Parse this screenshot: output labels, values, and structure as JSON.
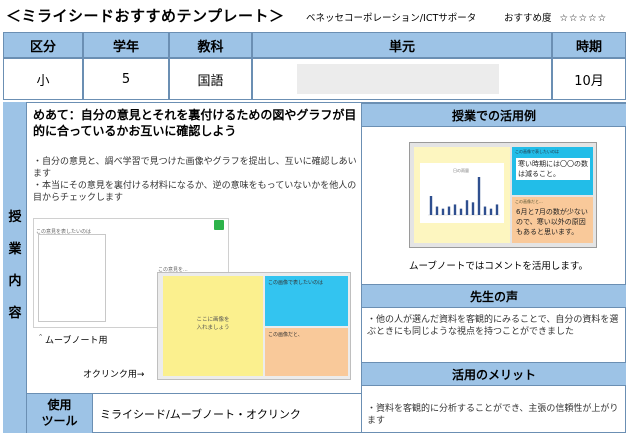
{
  "header": {
    "title": "＜ミライシードおすすめテンプレート＞",
    "org": "ベネッセコーポレーション/ICTサポータ",
    "recommend_label": "おすすめ度",
    "recommend_stars": "☆☆☆☆☆"
  },
  "table": {
    "columns": [
      "区分",
      "学年",
      "教科",
      "単元",
      "時期"
    ],
    "values": [
      "小",
      "5",
      "国語",
      "",
      "10月"
    ]
  },
  "side_label": [
    "授",
    "業",
    "内",
    "容"
  ],
  "lesson": {
    "meate": "めあて：自分の意見とそれを裏付けるための図やグラフが目的に合っているかお互いに確認しよう",
    "bullets": [
      "・自分の意見と、調べ学習で見つけた画像やグラフを提出し、互いに確認しあいます",
      "・本当にその意見を裏付ける材料になるか、逆の意味をもっていないかを他人の目からチェックします"
    ],
    "movenote_screen_title": "この意見を表したいのは",
    "movenote_screen2_title": "この意見を...",
    "movenote_caption": "＾ムーブノート用",
    "oclink_yellow_text": "ここに画像を\n入れましょう",
    "oclink_cyan_label": "この画像で表したいのは",
    "oclink_orange_label": "この画像だと、",
    "oclink_caption": "オクリンク用→"
  },
  "tools": {
    "label": "使用\nツール",
    "value": "ミライシード/ムーブノート・オクリンク"
  },
  "right": {
    "usage_title": "授業での活用例",
    "example_chart_title": "日の雨量",
    "example_cyan_label": "この画像で表したいのは",
    "example_note": "寒い時期には〇〇の数は減ること。",
    "example_orange_label": "この画像だと...",
    "example_orange_text": "6月と7月の数が少ないので、寒い以外の原因もあると思います。",
    "usage_caption": "ムーブノートではコメントを活用します。",
    "voice_title": "先生の声",
    "voice_text": "・他の人が選んだ資料を客観的にみることで、自分の資料を選ぶときにも同じような視点を持つことができました",
    "merit_title": "活用のメリット",
    "merit_text": "・資料を客観的に分析することができ、主張の信頼性が上がります"
  },
  "example_chart": {
    "chart_data": {
      "type": "bar",
      "title": "日の雨量",
      "values": [
        9,
        4,
        3,
        4,
        5,
        3,
        7,
        6,
        18,
        4,
        3,
        5
      ]
    }
  },
  "colors": {
    "header_blue": "#9dc3e6",
    "sticky_yellow": "#fbf08e",
    "sticky_cyan": "#33c4f0",
    "sticky_orange": "#f9c99a",
    "bar_blue": "#2f4f8f"
  }
}
